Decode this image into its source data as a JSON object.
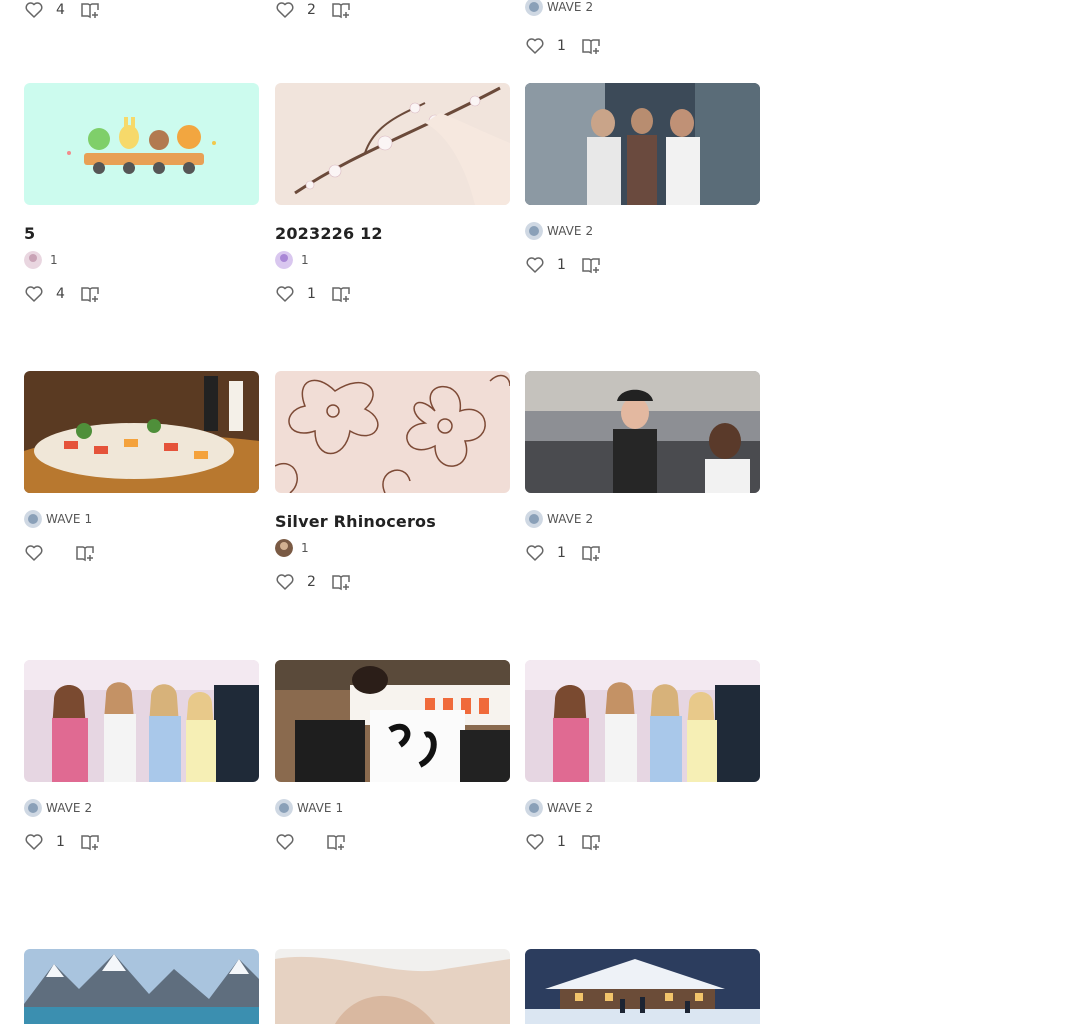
{
  "top_row": [
    {
      "likes": "4"
    },
    {
      "likes": "2"
    },
    {
      "author": "WAVE",
      "time": "2",
      "likes": "1"
    }
  ],
  "cards": [
    {
      "title": "5",
      "author": "",
      "time": "1",
      "likes": "4",
      "image": "kids-train-illustration"
    },
    {
      "title": " 2023226 12",
      "author": "",
      "time": "1",
      "likes": "1",
      "image": "cherry-blossom-branch"
    },
    {
      "title": " ",
      "author": "WAVE",
      "time": "2",
      "likes": "1",
      "image": "restaurant-staff-photo"
    },
    {
      "title": "",
      "author": "WAVE",
      "time": "1",
      "likes": "",
      "image": "sushi-boat-photo"
    },
    {
      "title": "Silver Rhinoceros",
      "author": "",
      "time": "1",
      "likes": "2",
      "image": "flower-line-pattern"
    },
    {
      "title": " ",
      "author": "WAVE",
      "time": "2",
      "likes": "1",
      "image": "barista-photo"
    },
    {
      "title": " ",
      "author": "WAVE",
      "time": "2",
      "likes": "1",
      "image": "girls-group-photo"
    },
    {
      "title": " ",
      "author": "WAVE",
      "time": "1",
      "likes": "",
      "image": "calligraphy-photo"
    },
    {
      "title": " ",
      "author": "WAVE",
      "time": "2",
      "likes": "1",
      "image": "girls-group-photo"
    }
  ],
  "bottom_row": [
    {
      "image": "mountain-lake-photo"
    },
    {
      "image": "hands-photo"
    },
    {
      "image": "winter-lodge-skating-photo"
    }
  ],
  "colors": {
    "text": "#222222",
    "meta": "#555555",
    "icon": "#666666"
  }
}
